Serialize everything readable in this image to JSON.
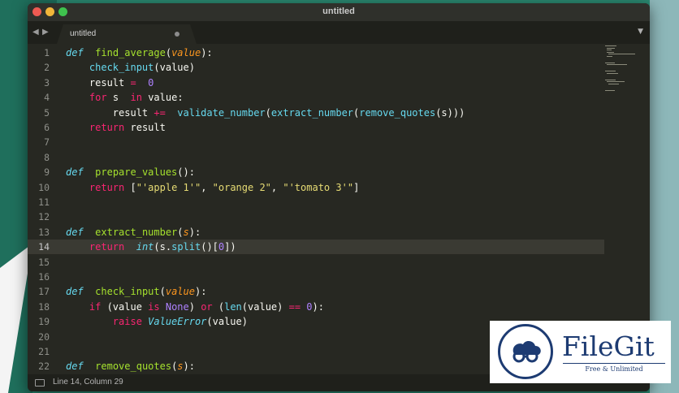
{
  "window": {
    "title": "untitled"
  },
  "tab": {
    "label": "untitled"
  },
  "colors": {
    "editor_bg": "#272822",
    "keyword": "#f92672",
    "function": "#a6e22e",
    "string": "#e6db74",
    "number": "#ae81ff"
  },
  "icons": {
    "back": "chevron-left-icon",
    "forward": "chevron-right-icon",
    "menu": "triangle-down-icon",
    "panel": "panel-icon"
  },
  "lines": [
    {
      "n": "1",
      "tokens": [
        [
          "df",
          "def"
        ],
        [
          "",
          "  "
        ],
        [
          "fn",
          "find_average"
        ],
        [
          "",
          "("
        ],
        [
          "pa",
          "value"
        ],
        [
          "",
          "):"
        ]
      ]
    },
    {
      "n": "2",
      "tokens": [
        [
          "",
          "    "
        ],
        [
          "bi",
          "check_input"
        ],
        [
          "",
          "(value)"
        ]
      ]
    },
    {
      "n": "3",
      "tokens": [
        [
          "",
          "    result "
        ],
        [
          "kw",
          "="
        ],
        [
          "",
          "",
          " "
        ],
        [
          "nu",
          " 0"
        ]
      ]
    },
    {
      "n": "4",
      "tokens": [
        [
          "",
          "    "
        ],
        [
          "kw",
          "for"
        ],
        [
          "",
          "",
          " s "
        ],
        [
          "kw",
          " in"
        ],
        [
          "",
          "",
          " value:"
        ]
      ]
    },
    {
      "n": "5",
      "tokens": [
        [
          "",
          "        result "
        ],
        [
          "kw",
          "+="
        ],
        [
          "",
          "",
          " "
        ],
        [
          "bi",
          " validate_number"
        ],
        [
          "",
          "("
        ],
        [
          "bi",
          "extract_number"
        ],
        [
          "",
          "("
        ],
        [
          "bi",
          "remove_quotes"
        ],
        [
          "",
          "(s)))"
        ]
      ]
    },
    {
      "n": "6",
      "tokens": [
        [
          "",
          "    "
        ],
        [
          "kw",
          "return"
        ],
        [
          "",
          "",
          " result"
        ]
      ]
    },
    {
      "n": "7",
      "tokens": []
    },
    {
      "n": "8",
      "tokens": []
    },
    {
      "n": "9",
      "tokens": [
        [
          "df",
          "def"
        ],
        [
          "",
          "  "
        ],
        [
          "fn",
          "prepare_values"
        ],
        [
          "",
          "():"
        ]
      ]
    },
    {
      "n": "10",
      "tokens": [
        [
          "",
          "    "
        ],
        [
          "kw",
          "return"
        ],
        [
          "",
          "",
          " ["
        ],
        [
          "st",
          "\"'apple 1'\""
        ],
        [
          "",
          ", "
        ],
        [
          "st",
          "\"orange 2\""
        ],
        [
          "",
          ", "
        ],
        [
          "st",
          "\"'tomato 3'\""
        ],
        [
          "",
          "]"
        ]
      ]
    },
    {
      "n": "11",
      "tokens": []
    },
    {
      "n": "12",
      "tokens": []
    },
    {
      "n": "13",
      "tokens": [
        [
          "df",
          "def"
        ],
        [
          "",
          "  "
        ],
        [
          "fn",
          "extract_number"
        ],
        [
          "",
          "("
        ],
        [
          "pa",
          "s"
        ],
        [
          "",
          "):"
        ]
      ]
    },
    {
      "n": "14",
      "current": true,
      "tokens": [
        [
          "",
          "    "
        ],
        [
          "kw",
          "return"
        ],
        [
          "",
          "",
          " "
        ],
        [
          "ex",
          " int"
        ],
        [
          "",
          "(s."
        ],
        [
          "bi",
          "split"
        ],
        [
          "",
          "()["
        ],
        [
          "nu",
          "0"
        ],
        [
          "",
          "])"
        ]
      ]
    },
    {
      "n": "15",
      "tokens": []
    },
    {
      "n": "16",
      "tokens": []
    },
    {
      "n": "17",
      "tokens": [
        [
          "df",
          "def"
        ],
        [
          "",
          "  "
        ],
        [
          "fn",
          "check_input"
        ],
        [
          "",
          "("
        ],
        [
          "pa",
          "value"
        ],
        [
          "",
          "):"
        ]
      ]
    },
    {
      "n": "18",
      "tokens": [
        [
          "",
          "    "
        ],
        [
          "kw",
          "if"
        ],
        [
          "",
          "",
          " (value "
        ],
        [
          "kw",
          "is"
        ],
        [
          "",
          "",
          " "
        ],
        [
          "nu",
          "None"
        ],
        [
          "",
          ") "
        ],
        [
          "kw",
          "or"
        ],
        [
          "",
          "",
          " ("
        ],
        [
          "bi",
          "len"
        ],
        [
          "",
          "(value) "
        ],
        [
          "kw",
          "=="
        ],
        [
          "",
          "",
          " "
        ],
        [
          "nu",
          "0"
        ],
        [
          "",
          "):"
        ]
      ]
    },
    {
      "n": "19",
      "tokens": [
        [
          "",
          "        "
        ],
        [
          "kw",
          "raise"
        ],
        [
          "",
          "",
          " "
        ],
        [
          "ex",
          "ValueError"
        ],
        [
          "",
          "(value)"
        ]
      ]
    },
    {
      "n": "20",
      "tokens": []
    },
    {
      "n": "21",
      "tokens": []
    },
    {
      "n": "22",
      "tokens": [
        [
          "df",
          "def"
        ],
        [
          "",
          "  "
        ],
        [
          "fn",
          "remove_quotes"
        ],
        [
          "",
          "("
        ],
        [
          "pa",
          "s"
        ],
        [
          "",
          "):"
        ]
      ]
    }
  ],
  "status": {
    "position": "Line 14, Column 29"
  },
  "watermark": {
    "name": "FileGit",
    "tagline": "Free & Unlimited"
  }
}
